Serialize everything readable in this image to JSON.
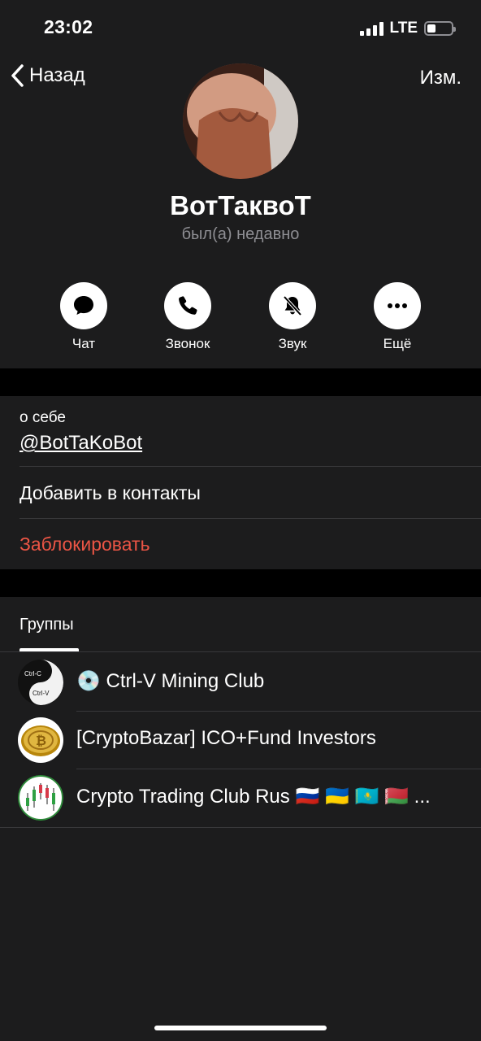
{
  "status_bar": {
    "time": "23:02",
    "network": "LTE"
  },
  "nav": {
    "back_label": "Назад",
    "edit_label": "Изм."
  },
  "profile": {
    "name": "ВотТаквоТ",
    "status": "был(а) недавно"
  },
  "actions": [
    {
      "label": "Чат",
      "icon": "chat-bubble-icon"
    },
    {
      "label": "Звонок",
      "icon": "phone-icon"
    },
    {
      "label": "Звук",
      "icon": "bell-muted-icon"
    },
    {
      "label": "Ещё",
      "icon": "more-icon"
    }
  ],
  "about": {
    "label": "о себе",
    "value": "@BotTaKoBot"
  },
  "menu": {
    "add_contact": "Добавить в контакты",
    "block": "Заблокировать"
  },
  "groups": {
    "tab_label": "Группы",
    "items": [
      {
        "title": "💿 Ctrl-V Mining Club",
        "avatar_top": "Ctrl-C",
        "avatar_bottom": "Ctrl-V"
      },
      {
        "title": "[CryptoBazar] ICO+Fund Investors"
      },
      {
        "title": "Crypto Trading Club Rus 🇷🇺 🇺🇦 🇰🇿 🇧🇾 ..."
      }
    ]
  },
  "colors": {
    "background": "#1c1c1d",
    "band": "#000000",
    "destructive": "#eb5545",
    "secondary_text": "#8e8e93"
  }
}
